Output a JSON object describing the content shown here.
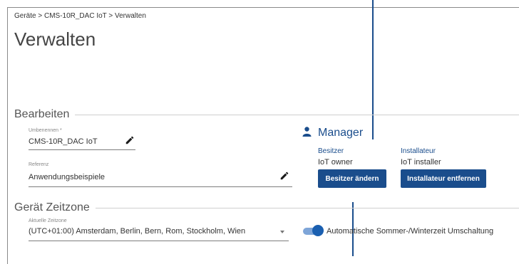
{
  "breadcrumb": "Geräte > CMS-10R_DAC IoT > Verwalten",
  "page_title": "Verwalten",
  "edit_section": {
    "title": "Bearbeiten",
    "rename": {
      "label": "Umbenennen *",
      "value": "CMS-10R_DAC IoT",
      "icon": "pencil-icon"
    },
    "reference": {
      "label": "Referenz",
      "value": "Anwendungsbeispiele",
      "icon": "pencil-icon"
    }
  },
  "manager": {
    "title": "Manager",
    "icon": "person-icon",
    "owner_label": "Besitzer",
    "owner_value": "IoT owner",
    "installer_label": "Installateur",
    "installer_value": "IoT installer",
    "change_owner_button": "Besitzer ändern",
    "remove_installer_button": "Installateur entfernen"
  },
  "timezone_section": {
    "title": "Gerät Zeitzone",
    "current_label": "Aktuelle Zeitzone",
    "current_value": "(UTC+01:00) Amsterdam, Berlin, Bern, Rom, Stockholm, Wien",
    "dst_toggle_label": "Automatische Sommer-/Winterzeit Umschaltung",
    "dst_enabled": true
  },
  "colors": {
    "accent": "#1a4d8c",
    "toggle_track": "#7ea5d8",
    "toggle_knob": "#1a5fb0"
  }
}
